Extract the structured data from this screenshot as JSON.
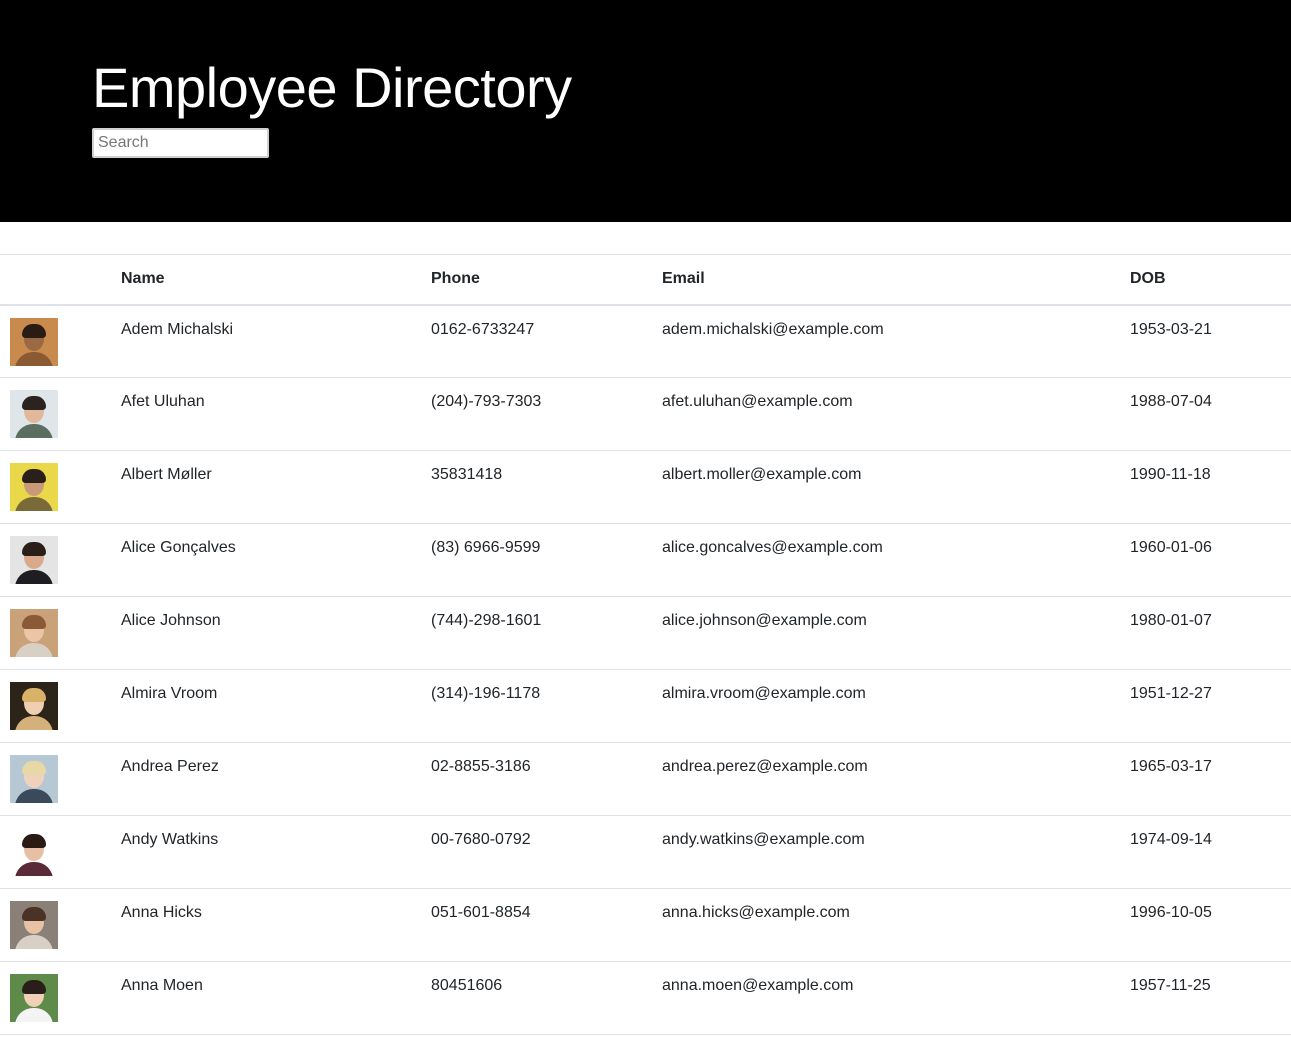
{
  "header": {
    "title": "Employee Directory",
    "search_placeholder": "Search",
    "search_value": ""
  },
  "table": {
    "columns": [
      "",
      "Name",
      "Phone",
      "Email",
      "DOB"
    ],
    "rows": [
      {
        "name": "Adem Michalski",
        "phone": "0162-6733247",
        "email": "adem.michalski@example.com",
        "dob": "1953-03-21",
        "avatar": {
          "bg": "#c98a4e",
          "skin": "#9a6a45",
          "hair": "#2a1c14",
          "shirt": "#8a5a32"
        }
      },
      {
        "name": "Afet Uluhan",
        "phone": "(204)-793-7303",
        "email": "afet.uluhan@example.com",
        "dob": "1988-07-04",
        "avatar": {
          "bg": "#dfe6ea",
          "skin": "#e2b89a",
          "hair": "#2b2320",
          "shirt": "#5b6e60"
        }
      },
      {
        "name": "Albert Møller",
        "phone": "35831418",
        "email": "albert.moller@example.com",
        "dob": "1990-11-18",
        "avatar": {
          "bg": "#e8d84a",
          "skin": "#c99a78",
          "hair": "#2a201a",
          "shirt": "#7a6a3a"
        }
      },
      {
        "name": "Alice Gonçalves",
        "phone": "(83) 6966-9599",
        "email": "alice.goncalves@example.com",
        "dob": "1960-01-06",
        "avatar": {
          "bg": "#e4e4e4",
          "skin": "#d9a98c",
          "hair": "#2a1e18",
          "shirt": "#1e1e22"
        }
      },
      {
        "name": "Alice Johnson",
        "phone": "(744)-298-1601",
        "email": "alice.johnson@example.com",
        "dob": "1980-01-07",
        "avatar": {
          "bg": "#c9a27a",
          "skin": "#ecc4a6",
          "hair": "#8a5a36",
          "shirt": "#d8d0c4"
        }
      },
      {
        "name": "Almira Vroom",
        "phone": "(314)-196-1178",
        "email": "almira.vroom@example.com",
        "dob": "1951-12-27",
        "avatar": {
          "bg": "#2c2418",
          "skin": "#efcfb2",
          "hair": "#d9b26a",
          "shirt": "#d4b07a"
        }
      },
      {
        "name": "Andrea Perez",
        "phone": "02-8855-3186",
        "email": "andrea.perez@example.com",
        "dob": "1965-03-17",
        "avatar": {
          "bg": "#b6c8d4",
          "skin": "#f0d2bc",
          "hair": "#e8d8a6",
          "shirt": "#3a4a5a"
        }
      },
      {
        "name": "Andy Watkins",
        "phone": "00-7680-0792",
        "email": "andy.watkins@example.com",
        "dob": "1974-09-14",
        "avatar": {
          "bg": "#ffffff",
          "skin": "#e6bfa4",
          "hair": "#2a1a14",
          "shirt": "#5a2a38"
        }
      },
      {
        "name": "Anna Hicks",
        "phone": "051-601-8854",
        "email": "anna.hicks@example.com",
        "dob": "1996-10-05",
        "avatar": {
          "bg": "#8a8078",
          "skin": "#e8c2a4",
          "hair": "#4a3226",
          "shirt": "#d8cfc6"
        }
      },
      {
        "name": "Anna Moen",
        "phone": "80451606",
        "email": "anna.moen@example.com",
        "dob": "1957-11-25",
        "avatar": {
          "bg": "#5e8a4a",
          "skin": "#f0d0b6",
          "hair": "#2a1e1a",
          "shirt": "#f4f4f4"
        }
      }
    ]
  }
}
